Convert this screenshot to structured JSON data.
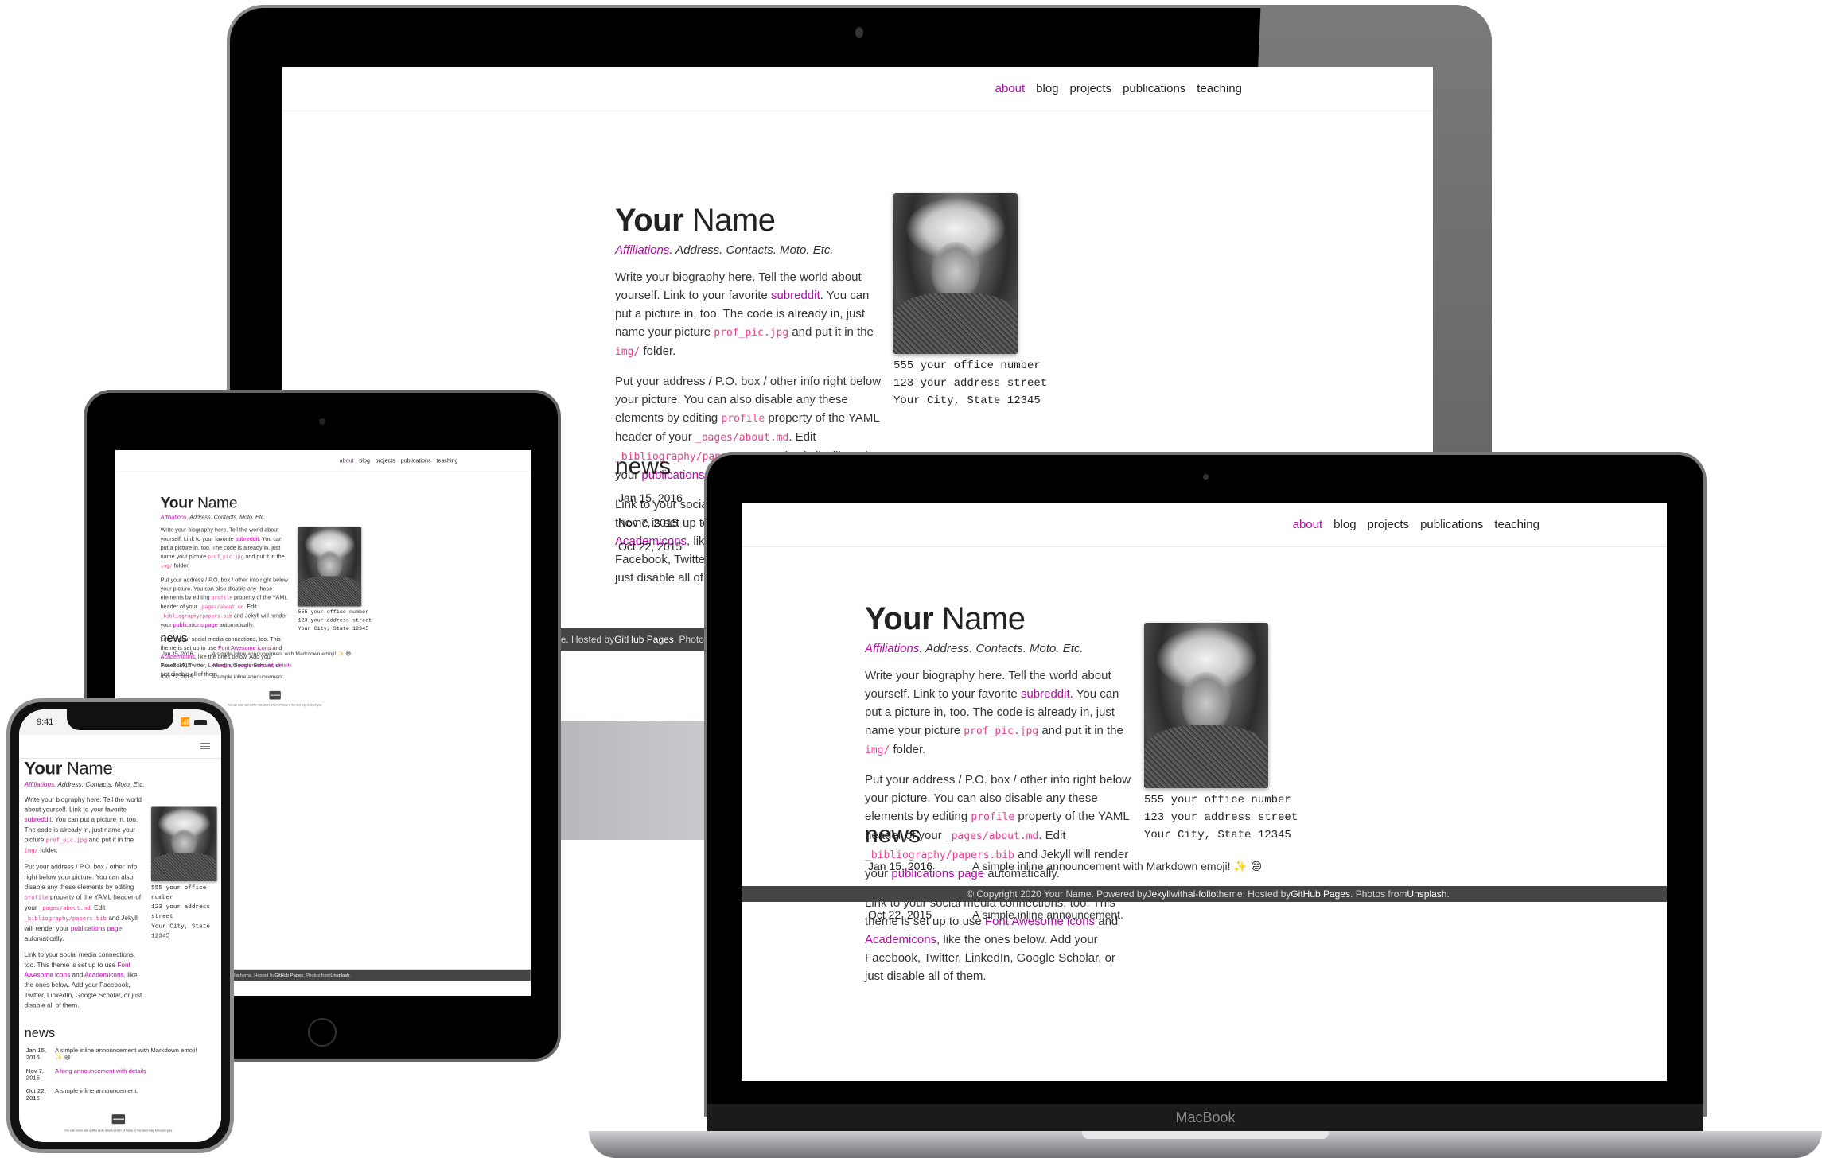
{
  "site": {
    "nav": [
      {
        "label": "about",
        "active": true
      },
      {
        "label": "blog",
        "active": false
      },
      {
        "label": "projects",
        "active": false
      },
      {
        "label": "publications",
        "active": false
      },
      {
        "label": "teaching",
        "active": false
      }
    ],
    "title_bold": "Your",
    "title_rest": " Name",
    "desc_link": "Affiliations",
    "desc_rest": ". Address. Contacts. Moto. Etc.",
    "bio": {
      "p1_a": "Write your biography here. Tell the world about yourself. Link to your favorite ",
      "p1_link": "subreddit",
      "p1_b": ". You can put a picture in, too. The code is already in, just name your picture ",
      "p1_code1": "prof_pic.jpg",
      "p1_c": " and put it in the ",
      "p1_code2": "img/",
      "p1_d": " folder.",
      "p2_a": "Put your address / P.O. box / other info right below your picture. You can also disable any these elements by editing ",
      "p2_code1": "profile",
      "p2_b": " property of the YAML header of your ",
      "p2_code2": "_pages/about.md",
      "p2_c": ". Edit ",
      "p2_code3": "_bibliography/papers.bib",
      "p2_d": " and Jekyll will render your ",
      "p2_link": "publications page",
      "p2_e": " automatically.",
      "p3_a": "Link to your social media connections, too. This theme is set up to use ",
      "p3_link1": "Font Awesome icons",
      "p3_b": " and ",
      "p3_link2": "Academicons",
      "p3_c": ", like the ones below. Add your Facebook, Twitter, LinkedIn, Google Scholar, or just disable all of them."
    },
    "address": "555 your office number\n123 your address street\nYour City, State 12345",
    "news_title": "news",
    "news": [
      {
        "date": "Jan 15, 2016",
        "text": "A simple inline announcement with Markdown emoji! ✨ 😄",
        "is_link": false
      },
      {
        "date": "Nov 7, 2015",
        "text": "A long announcement with details",
        "is_link": true
      },
      {
        "date": "Oct 22, 2015",
        "text": "A simple inline announcement.",
        "is_link": false
      }
    ],
    "contact_note": "You can even add a little note about which of these is the best way to reach you.",
    "footer": {
      "prefix": "© Copyright 2020 Your Name. Powered by ",
      "jekyll": "Jekyll",
      "mid1": " with ",
      "theme": "al-folio",
      "mid2": " theme. Hosted by ",
      "host": "GitHub Pages",
      "mid3": ". Photos from ",
      "photos": "Unsplash",
      "suffix": "."
    }
  },
  "iphone": {
    "time": "9:41"
  },
  "macbook": {
    "brand": "MacBook"
  },
  "colors": {
    "accent": "#b509ac",
    "code": "#e83e8c",
    "footer_bg": "#454545"
  }
}
